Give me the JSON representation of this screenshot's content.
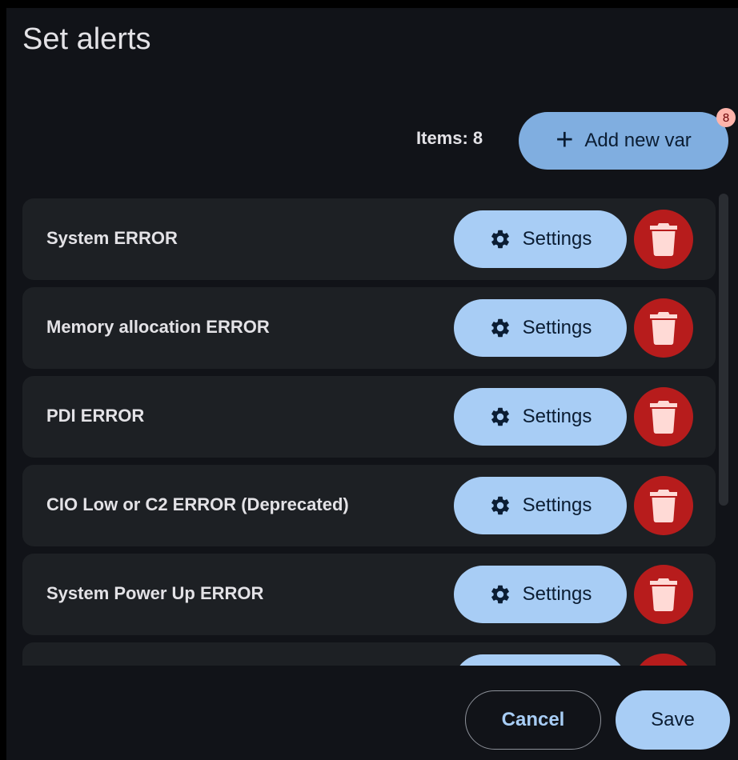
{
  "dialog": {
    "title": "Set alerts"
  },
  "toolbar": {
    "items_count": "Items: 8",
    "add_label": "Add new var",
    "add_icon": "plus-icon",
    "badge_count": "8"
  },
  "alerts": [
    {
      "label": "System ERROR",
      "settings_label": "Settings"
    },
    {
      "label": "Memory allocation ERROR",
      "settings_label": "Settings"
    },
    {
      "label": "PDI ERROR",
      "settings_label": "Settings"
    },
    {
      "label": "CIO Low or C2 ERROR (Deprecated)",
      "settings_label": "Settings"
    },
    {
      "label": "System Power Up ERROR",
      "settings_label": "Settings"
    },
    {
      "label": "",
      "settings_label": ""
    }
  ],
  "icons": {
    "settings": "gear-icon",
    "delete": "trash-icon"
  },
  "footer": {
    "cancel_label": "Cancel",
    "save_label": "Save"
  },
  "colors": {
    "surface": "#111318",
    "row_background": "#1d2024",
    "primary_container": "#a8cdf5",
    "add_button": "#80aee0",
    "danger": "#b71c1c",
    "danger_icon": "#ffdad6",
    "badge": "#ffb4ab",
    "text": "#e3e2e6"
  }
}
